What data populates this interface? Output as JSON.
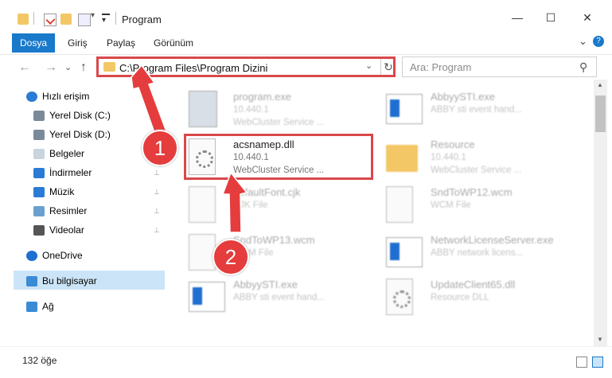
{
  "window": {
    "title": "Program",
    "quick_access_menu": "▾",
    "controls": {
      "minimize": "—",
      "maximize": "☐",
      "close": "✕"
    }
  },
  "ribbon": {
    "tabs": [
      "Dosya",
      "Giriş",
      "Paylaş",
      "Görünüm"
    ],
    "expand_glyph": "⌄",
    "help_glyph": "?"
  },
  "navigation": {
    "back": "←",
    "forward": "→",
    "recent": "⌄",
    "up": "↑",
    "address": "C:\\Program Files\\Program Dizini",
    "dropdown": "⌄",
    "refresh": "↻",
    "search_placeholder": "Ara: Program",
    "search_glyph": "⚲"
  },
  "sidebar": {
    "items": [
      {
        "label": "Hızlı erişim",
        "icon": "star-icon"
      },
      {
        "label": "Yerel Disk (C:)",
        "icon": "drive-icon",
        "pinned": true
      },
      {
        "label": "Yerel Disk (D:)",
        "icon": "drive-icon",
        "pinned": false
      },
      {
        "label": "Belgeler",
        "icon": "documents-icon",
        "pinned": true
      },
      {
        "label": "İndirmeler",
        "icon": "download-icon",
        "pinned": true
      },
      {
        "label": "Müzik",
        "icon": "music-icon",
        "pinned": true
      },
      {
        "label": "Resimler",
        "icon": "pictures-icon",
        "pinned": true
      },
      {
        "label": "Videolar",
        "icon": "videos-icon",
        "pinned": true
      },
      {
        "label": "OneDrive",
        "icon": "cloud-icon"
      },
      {
        "label": "Bu bilgisayar",
        "icon": "computer-icon",
        "selected": true
      },
      {
        "label": "Ağ",
        "icon": "network-icon"
      }
    ],
    "pin_glyph": "📌"
  },
  "files": [
    {
      "name": "program.exe",
      "line1": "10.440.1",
      "line2": "WebCluster Service ...",
      "icon": "exe-icon"
    },
    {
      "name": "AbbyySTI.exe",
      "line1": "ABBY sti event hand...",
      "line2": "",
      "icon": "app-icon"
    },
    {
      "name": "acsnamep.dll",
      "line1": "10.440.1",
      "line2": "WebCluster Service ...",
      "icon": "dll-icon",
      "highlighted": true
    },
    {
      "name": "Resource",
      "line1": "10.440.1",
      "line2": "WebCluster Service ...",
      "icon": "folder-icon"
    },
    {
      "name": "defaultFont.cjk",
      "line1": "CJK File",
      "line2": "",
      "icon": "file-icon"
    },
    {
      "name": "SndToWP12.wcm",
      "line1": "WCM File",
      "line2": "",
      "icon": "file-icon"
    },
    {
      "name": "SndToWP13.wcm",
      "line1": "WCM File",
      "line2": "",
      "icon": "file-icon"
    },
    {
      "name": "NetworkLicenseServer.exe",
      "line1": "ABBY network licens...",
      "line2": "",
      "icon": "app-icon"
    },
    {
      "name": "AbbyySTI.exe",
      "line1": "ABBY sti event hand...",
      "line2": "",
      "icon": "app-icon"
    },
    {
      "name": "UpdateClient65.dll",
      "line1": "Resource DLL",
      "line2": "",
      "icon": "dll-icon"
    }
  ],
  "status": {
    "item_count": "132 öğe"
  },
  "annotations": {
    "step1": "1",
    "step2": "2"
  },
  "colors": {
    "accent": "#1979ca",
    "highlight": "#d9484a",
    "badge": "#e53c3d",
    "selected": "#cce4f7"
  }
}
